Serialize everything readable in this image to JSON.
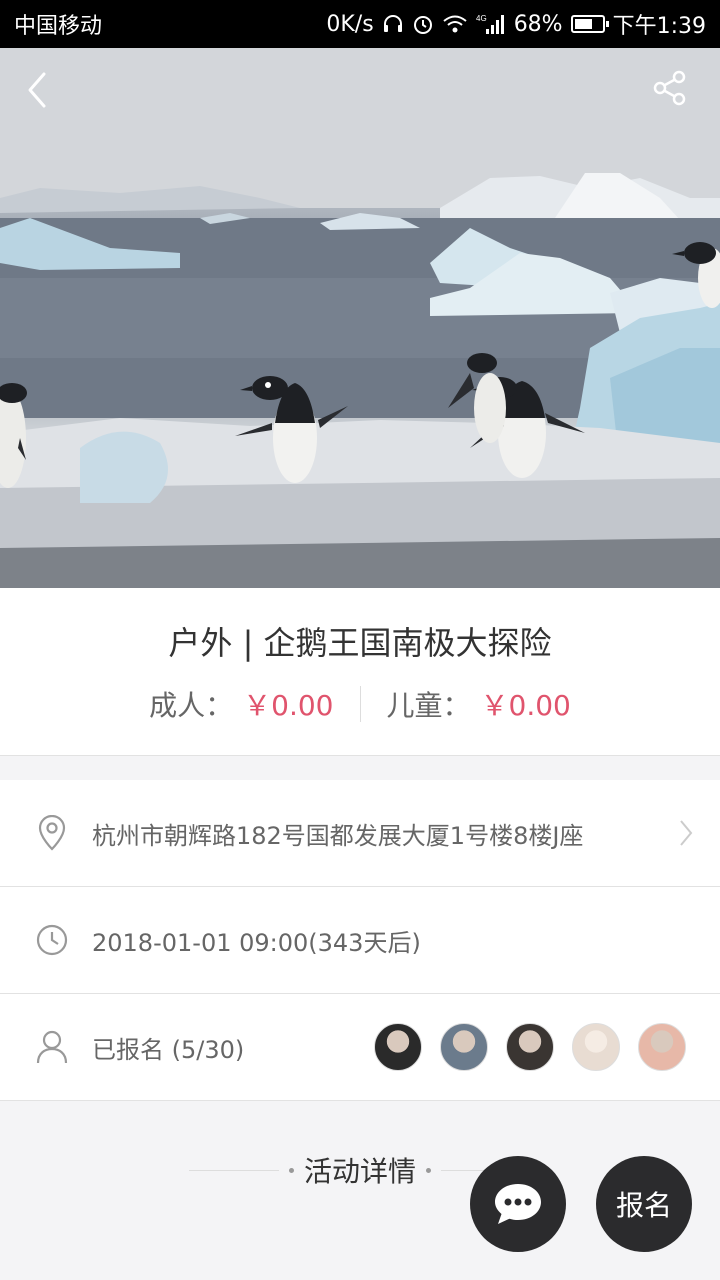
{
  "status_bar": {
    "carrier": "中国移动",
    "net_speed": "0K/s",
    "network": "4G",
    "battery": "68%",
    "battery_level": 0.68,
    "time": "下午1:39"
  },
  "header": {
    "back_icon": "chevron-left-icon",
    "share_icon": "share-icon",
    "hero_image": "penguins-on-antarctic-ice"
  },
  "event": {
    "title": "户外 | 企鹅王国南极大探险",
    "adult_label": "成人：",
    "adult_price": "￥0.00",
    "child_label": "儿童：",
    "child_price": "￥0.00",
    "price_color": "#e0546d"
  },
  "info": {
    "address": "杭州市朝辉路182号国都发展大厦1号楼8楼J座",
    "datetime": "2018-01-01 09:00(343天后)",
    "signup": "已报名 (5/30)"
  },
  "attendees": [
    {
      "name": "avatar-1",
      "color": "#2a2a2a"
    },
    {
      "name": "avatar-2",
      "color": "#6b7b8c"
    },
    {
      "name": "avatar-3",
      "color": "#3a3532"
    },
    {
      "name": "avatar-4",
      "color": "#e8dcd2"
    },
    {
      "name": "avatar-5",
      "color": "#e7b8a8"
    }
  ],
  "details": {
    "title": "活动详情"
  },
  "actions": {
    "chat_icon": "chat-bubble-icon",
    "signup_label": "报名"
  }
}
